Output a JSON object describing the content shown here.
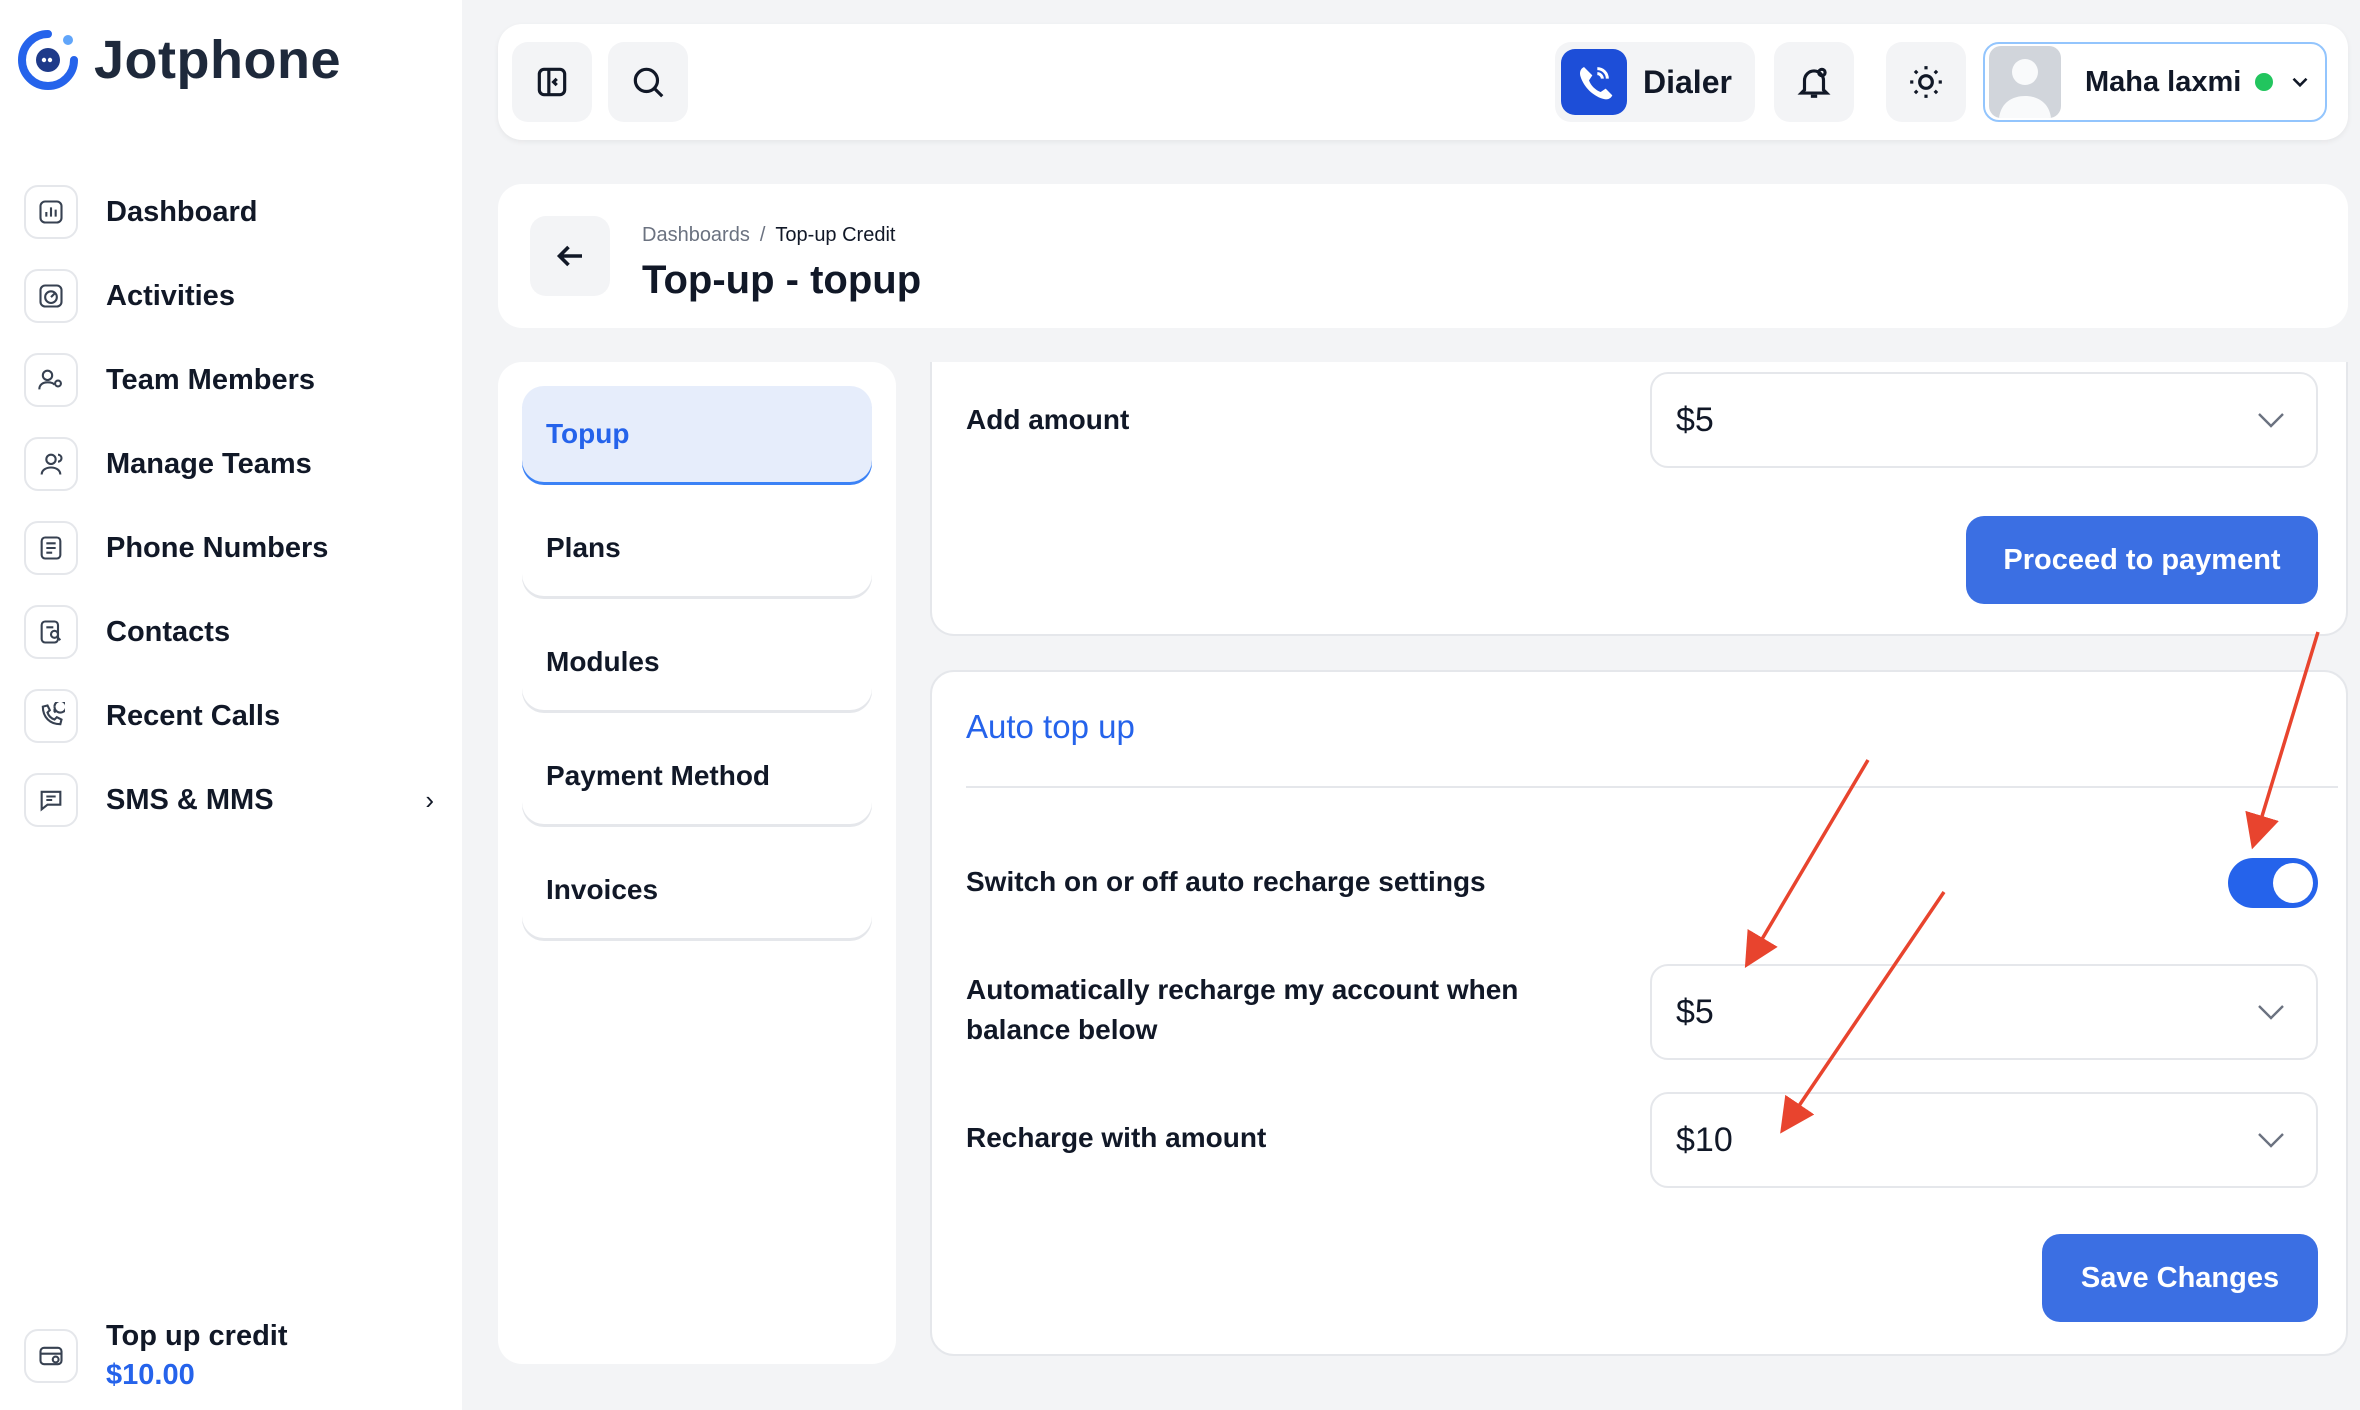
{
  "app": {
    "name": "Jotphone"
  },
  "sidebar": {
    "items": [
      {
        "label": "Dashboard",
        "icon": "chart-bar-icon"
      },
      {
        "label": "Activities",
        "icon": "gauge-icon"
      },
      {
        "label": "Team Members",
        "icon": "user-settings-icon"
      },
      {
        "label": "Manage Teams",
        "icon": "users-icon"
      },
      {
        "label": "Phone Numbers",
        "icon": "phone-book-icon"
      },
      {
        "label": "Contacts",
        "icon": "contact-list-icon"
      },
      {
        "label": "Recent Calls",
        "icon": "phone-history-icon"
      },
      {
        "label": "SMS & MMS",
        "icon": "message-icon"
      }
    ],
    "credit": {
      "label": "Top up credit",
      "value": "$10.00"
    }
  },
  "header": {
    "dialer_label": "Dialer",
    "user_name": "Maha laxmi",
    "status_color": "#22c55e"
  },
  "breadcrumb": {
    "items": [
      "Dashboards",
      "Top-up Credit"
    ],
    "separator": "/",
    "title": "Top-up - topup"
  },
  "tabs": [
    "Topup",
    "Plans",
    "Modules",
    "Payment Method",
    "Invoices"
  ],
  "active_tab": "Topup",
  "topup": {
    "add_amount_label": "Add amount",
    "add_amount_value": "$5",
    "proceed_label": "Proceed to payment"
  },
  "auto_topup": {
    "title": "Auto top up",
    "switch_label": "Switch on or off auto recharge settings",
    "switch_on": true,
    "threshold_label_line1": "Automatically recharge my account when",
    "threshold_label_line2": "balance below",
    "threshold_value": "$5",
    "recharge_label": "Recharge with amount",
    "recharge_value": "$10",
    "save_label": "Save Changes"
  },
  "colors": {
    "accent": "#2563eb",
    "button": "#3b6fe3",
    "annotation_arrow": "#e8442e"
  }
}
